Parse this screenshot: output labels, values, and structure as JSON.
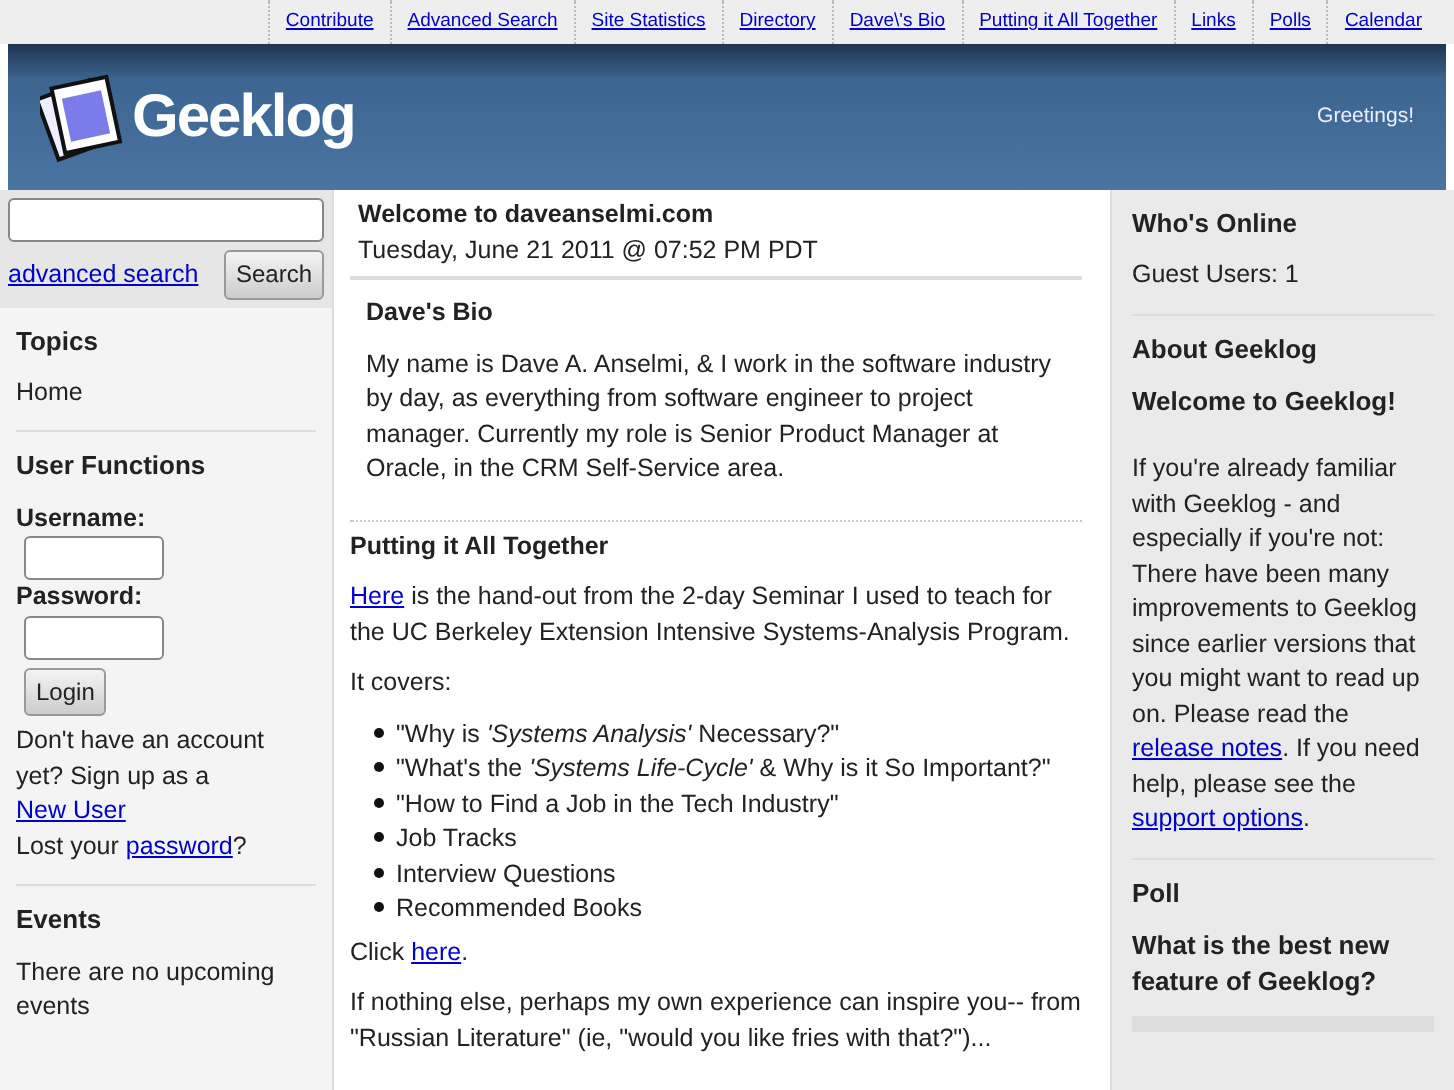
{
  "top_nav": [
    {
      "label": "Contribute"
    },
    {
      "label": "Advanced Search"
    },
    {
      "label": "Site Statistics"
    },
    {
      "label": "Directory"
    },
    {
      "label": "Dave\\'s Bio"
    },
    {
      "label": "Putting it All Together"
    },
    {
      "label": "Links"
    },
    {
      "label": "Polls"
    },
    {
      "label": "Calendar"
    }
  ],
  "header": {
    "logo": "Geeklog",
    "greeting": "Greetings!"
  },
  "left": {
    "search": {
      "advanced_link": "advanced search",
      "button": "Search"
    },
    "topics": {
      "title": "Topics",
      "items": [
        "Home"
      ]
    },
    "user_functions": {
      "title": "User Functions",
      "username_label": "Username:",
      "password_label": "Password:",
      "login_button": "Login",
      "signup": [
        {
          "text": "Don't have an account yet? Sign up as a "
        },
        {
          "text": "New User",
          "link": true
        }
      ],
      "lost": [
        {
          "text": "Lost your "
        },
        {
          "text": "password",
          "link": true
        },
        {
          "text": "?"
        }
      ]
    },
    "events": {
      "title": "Events",
      "text": "There are no upcoming events"
    }
  },
  "center": {
    "title": "Welcome to daveanselmi.com",
    "date": "Tuesday, June 21 2011 @ 07:52 PM PDT",
    "bio": {
      "title": "Dave's Bio",
      "text": "My name is Dave A. Anselmi, & I work in the software industry by day, as everything from software engineer to project manager. Currently my role is Senior Product Manager at Oracle, in the CRM Self-Service area."
    },
    "article": {
      "title": "Putting it All Together",
      "intro": [
        {
          "text": "Here",
          "link": true
        },
        {
          "text": " is the hand-out from the 2-day Seminar I used to teach for the UC Berkeley Extension Intensive Systems-Analysis Program."
        }
      ],
      "covers": "It covers:",
      "items": [
        "\"Why is *'Systems Analysis'* Necessary?\"",
        "\"What's the *'Systems Life-Cycle'* & Why is it So Important?\"",
        "\"How to Find a Job in the Tech Industry\"",
        "Job Tracks",
        "Interview Questions",
        "Recommended Books"
      ],
      "click": [
        {
          "text": "Click "
        },
        {
          "text": "here",
          "link": true
        },
        {
          "text": "."
        }
      ],
      "closing": "If nothing else, perhaps my own experience can inspire you-- from \"Russian Literature\" (ie, \"would you like fries with that?\")..."
    }
  },
  "right": {
    "whos_online": {
      "title": "Who's Online",
      "text": "Guest Users: 1"
    },
    "about": {
      "title": "About Geeklog",
      "subtitle": "Welcome to Geeklog!",
      "text": [
        {
          "text": "If you're already familiar with Geeklog - and especially if you're not: There have been many improvements to Geeklog since earlier versions that you might want to read up on. Please read the "
        },
        {
          "text": "release notes",
          "link": true
        },
        {
          "text": ". If you need help, please see the "
        },
        {
          "text": "support options",
          "link": true
        },
        {
          "text": "."
        }
      ]
    },
    "poll": {
      "title": "Poll",
      "question": "What is the best new feature of Geeklog?"
    }
  }
}
